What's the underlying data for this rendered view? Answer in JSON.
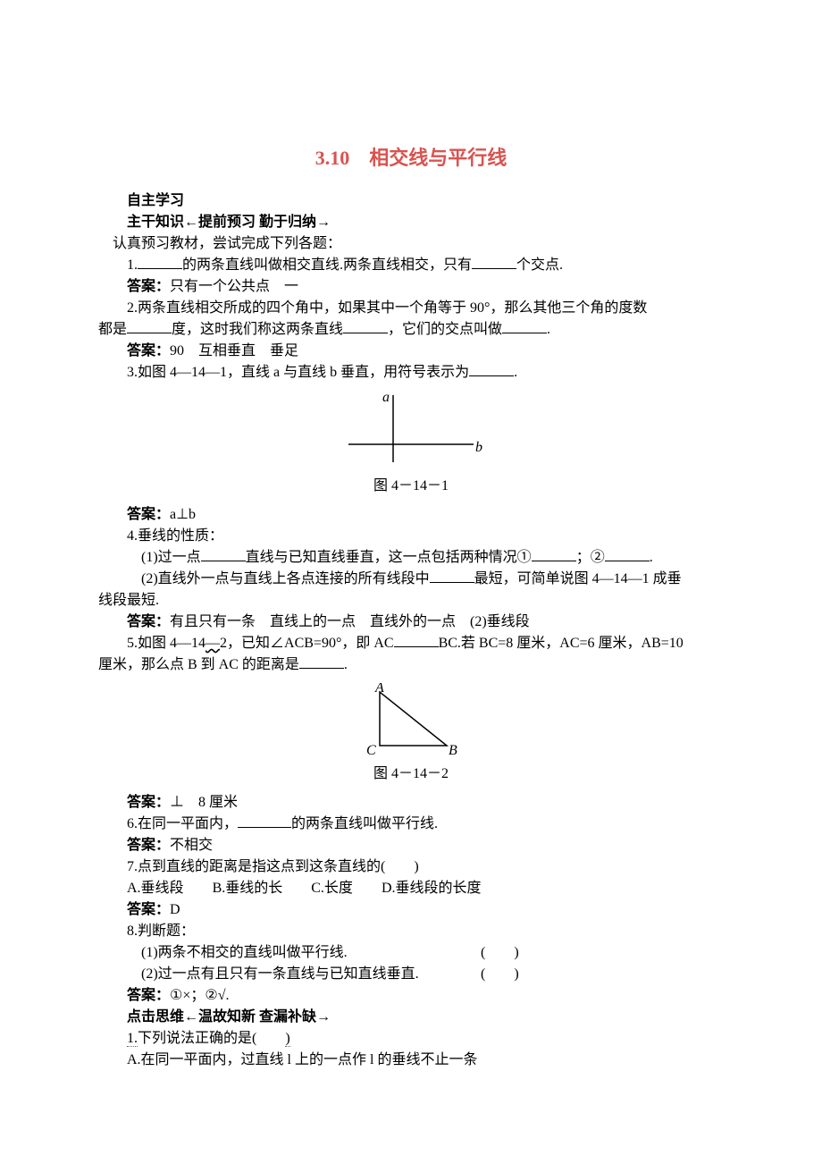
{
  "title": "3.10　相交线与平行线",
  "sec1_heading": "自主学习",
  "sec1_sub": "主干知识←提前预习 勤于归纳→",
  "intro": "认真预习教材，尝试完成下列各题：",
  "q1_a": "1.",
  "q1_b": "的两条直线叫做相交直线.两条直线相交，只有",
  "q1_c": "个交点.",
  "a1_label": "答案：",
  "a1_text": "只有一个公共点　一",
  "q2_a": "2.两条直线相交所成的四个角中，如果其中一个角等于 90°，那么其他三个角的度数",
  "q2_b": "都是",
  "q2_c": "度，这时我们称这两条直线",
  "q2_d": "，它们的交点叫做",
  "q2_e": ".",
  "a2_label": "答案：",
  "a2_text": "90　互相垂直　垂足",
  "q3_a": "3.如图 4—14—1，直线 a 与直线 b 垂直，用符号表示为",
  "q3_b": ".",
  "fig1_cap": "图 4－14－1",
  "fig1_label_a": "a",
  "fig1_label_b": "b",
  "a3_label": "答案：",
  "a3_text": "a⊥b",
  "q4_head": "4.垂线的性质：",
  "q4_1a": "(1)过一点",
  "q4_1b": "直线与已知直线垂直，这一点包括两种情况①",
  "q4_1c": "；②",
  "q4_1d": ".",
  "q4_2a": "(2)直线外一点与直线上各点连接的所有线段中",
  "q4_2b": "最短，可简单说图 4—14—1 成垂",
  "q4_2c": "线段最短.",
  "a4_label": "答案：",
  "a4_text": "有且只有一条　直线上的一点　直线外的一点　(2)垂线段",
  "q5_a": "5.如图 4—14—2，已知∠ACB=90°，即 AC",
  "q5_b": "BC.若 BC=8 厘米，AC=6 厘米，AB=10",
  "q5_c": "厘米，那么点 B 到 AC 的距离是",
  "q5_d": ".",
  "fig2_cap": "图 4－14－2",
  "fig2_A": "A",
  "fig2_B": "B",
  "fig2_C": "C",
  "a5_label": "答案：",
  "a5_text": "⊥　8 厘米",
  "q6_a": "6.在同一平面内，",
  "q6_b": "的两条直线叫做平行线.",
  "a6_label": "答案：",
  "a6_text": "不相交",
  "q7": "7.点到直线的距离是指这点到这条直线的(　　)",
  "q7_A": "A.垂线段",
  "q7_B": "B.垂线的长",
  "q7_C": "C.长度",
  "q7_D": "D.垂线段的长度",
  "a7_label": "答案：",
  "a7_text": "D",
  "q8": "8.判断题：",
  "q8_1": "(1)两条不相交的直线叫做平行线.",
  "q8_2": "(2)过一点有且只有一条直线与已知直线垂直.",
  "paren_blank": "(　　)",
  "a8_label": "答案：",
  "a8_text": "①×；②√.",
  "sec2_sub": "点击思维←温故知新 查漏补缺→",
  "s2_q1": "1.下列说法正确的是(　　)",
  "s2_q1_A": "A.在同一平面内，过直线 l 上的一点作 l 的垂线不止一条"
}
